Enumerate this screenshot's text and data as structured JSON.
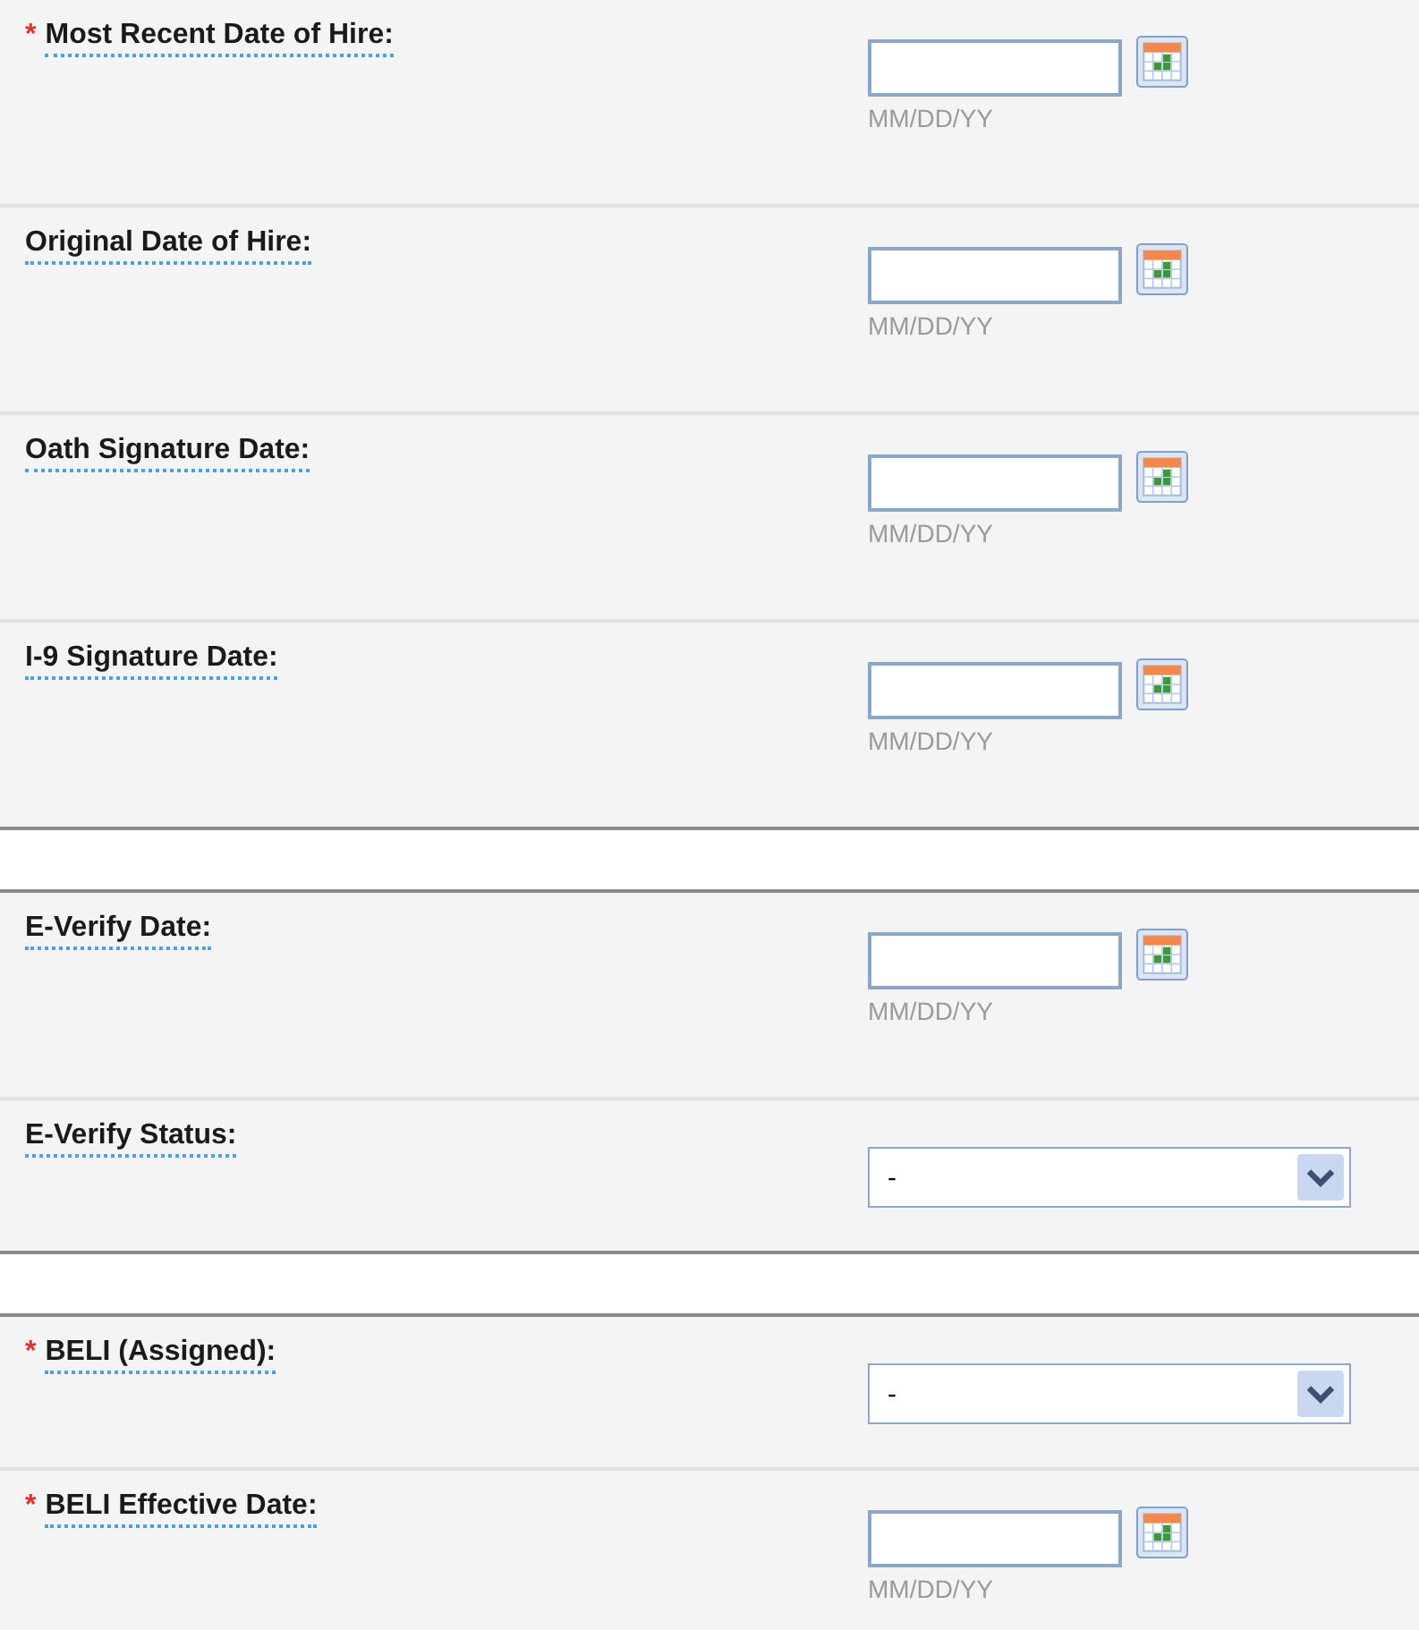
{
  "sections": [
    {
      "rows": [
        {
          "kind": "date",
          "marker": "*",
          "label": "Most Recent Date of Hire:",
          "hint": "MM/DD/YY"
        },
        {
          "kind": "date",
          "label": "Original Date of Hire:",
          "hint": "MM/DD/YY"
        },
        {
          "kind": "date",
          "label": "Oath Signature Date:",
          "hint": "MM/DD/YY"
        },
        {
          "kind": "date",
          "label": "I-9 Signature Date:",
          "hint": "MM/DD/YY"
        }
      ]
    },
    {
      "rows": [
        {
          "kind": "date",
          "label": "E-Verify Date:",
          "hint": "MM/DD/YY"
        },
        {
          "kind": "select",
          "label": "E-Verify Status:",
          "value": "-"
        }
      ]
    },
    {
      "rows": [
        {
          "kind": "select",
          "marker": "*",
          "label": "BELI (Assigned):",
          "value": "-"
        },
        {
          "kind": "date",
          "marker": "*",
          "label": "BELI Effective Date:",
          "hint": "MM/DD/YY"
        }
      ]
    }
  ]
}
